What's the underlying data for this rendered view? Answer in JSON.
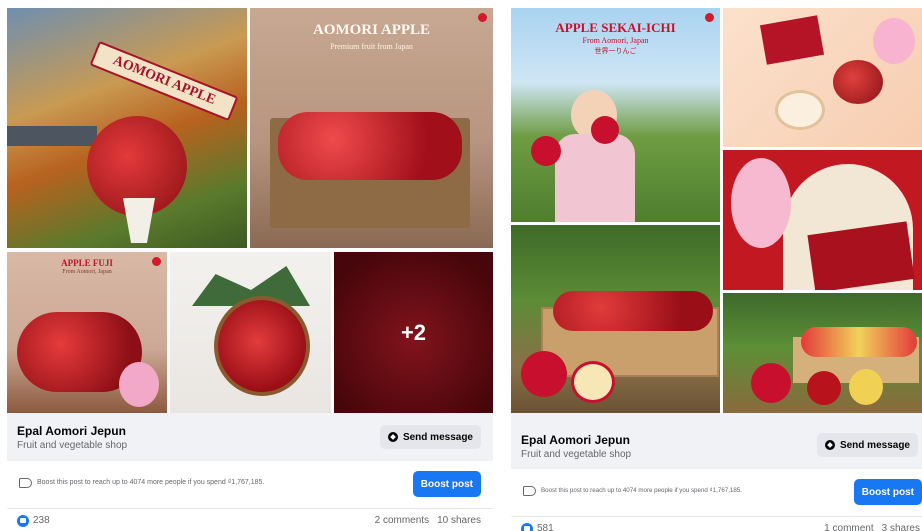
{
  "posts": [
    {
      "page_name": "Epal Aomori Jepun",
      "category": "Fruit and vegetable shop",
      "send_message_label": "Send message",
      "boost_text": "Boost this post to reach up to 4074 more people if you spend ₫1,767,185.",
      "boost_label": "Boost post",
      "reactions": "238",
      "comments": "2 comments",
      "shares": "10 shares",
      "tiles": {
        "ribbon": "AOMORI APPLE",
        "main_title": "AOMORI APPLE",
        "main_subtitle": "Premium fruit from Japan",
        "fuji_title": "APPLE FUJI",
        "fuji_subtitle": "From Aomori, Japan",
        "more_count": "+2"
      }
    },
    {
      "page_name": "Epal Aomori Jepun",
      "category": "Fruit and vegetable shop",
      "send_message_label": "Send message",
      "boost_text": "Boost this post to reach up to 4074 more people if you spend ₫1,767,185.",
      "boost_label": "Boost post",
      "reactions": "581",
      "comments": "1 comment",
      "shares": "3 shares",
      "tiles": {
        "main_title": "APPLE SEKAI-ICHI",
        "main_subtitle": "From Aomori, Japan",
        "main_jp": "世界一りんご"
      }
    }
  ],
  "colors": {
    "brand_red": "#c8102e",
    "facebook_blue": "#1877f2",
    "muted_text": "#65676b",
    "page_row_bg": "#f0f2f5"
  },
  "icons": [
    "send-message-icon",
    "megaphone-icon",
    "like-reaction-icon",
    "brand-logo-icon"
  ]
}
